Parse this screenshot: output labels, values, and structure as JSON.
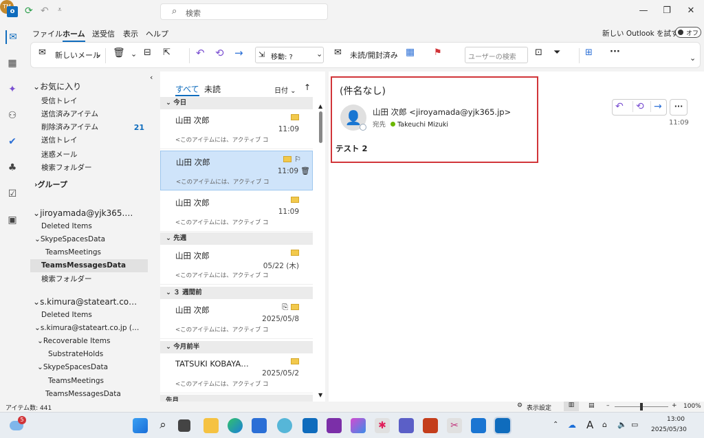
{
  "titlebar": {
    "search_placeholder": "検索",
    "avatar_initials": "TM"
  },
  "menu": {
    "tabs": [
      "ファイル",
      "ホーム",
      "送受信",
      "表示",
      "ヘルプ"
    ],
    "new_outlook_label": "新しい Outlook を試す",
    "toggle_label": "オフ"
  },
  "ribbon": {
    "new_mail": "新しいメール",
    "move_label": "移動: ?",
    "read_unread": "未読/開封済み",
    "user_search_placeholder": "ユーザーの検索",
    "more": "···"
  },
  "folders": {
    "favorites_header": "お気に入り",
    "favorites": [
      "受信トレイ",
      "送信済みアイテム",
      "削除済みアイテム",
      "送信トレイ",
      "迷惑メール",
      "検索フォルダー"
    ],
    "deleted_count": "21",
    "groups_header": "グループ",
    "account1_header": "jiroyamada@yjk365.…",
    "account1_items": [
      "Deleted Items",
      "SkypeSpacesData",
      "TeamsMeetings",
      "TeamsMessagesData",
      "検索フォルダー"
    ],
    "account2_header": "s.kimura@stateart.co…",
    "account2_items": [
      "Deleted Items",
      "s.kimura@stateart.co.jp (…",
      "Recoverable Items",
      "SubstrateHolds",
      "SkypeSpacesData",
      "TeamsMeetings",
      "TeamsMessagesData"
    ]
  },
  "list": {
    "tab_all": "すべて",
    "tab_unread": "未読",
    "sort_label": "日付",
    "groups": [
      "今日",
      "先週",
      "３ 週間前",
      "今月前半"
    ],
    "messages": [
      {
        "sender": "山田 次郎",
        "time": "11:09",
        "preview": "<このアイテムには、アクティブ コ"
      },
      {
        "sender": "山田 次郎",
        "time": "11:09",
        "preview": "<このアイテムには、アクティブ コ"
      },
      {
        "sender": "山田 次郎",
        "time": "11:09",
        "preview": "<このアイテムには、アクティブ コ"
      },
      {
        "sender": "山田 次郎",
        "time": "05/22 (木)",
        "preview": "<このアイテムには、アクティブ コ"
      },
      {
        "sender": "山田 次郎",
        "time": "2025/05/8",
        "preview": "<このアイテムには、アクティブ コ"
      },
      {
        "sender": "TATSUKI KOBAYA…",
        "time": "2025/05/2",
        "preview": "<このアイテムには、アクティブ コ"
      }
    ],
    "bottom_group": "先月"
  },
  "reading": {
    "subject": "(件名なし)",
    "from": "山田 次郎 <jiroyamada@yjk365.jp>",
    "to_label": "宛先",
    "to": "Takeuchi Mizuki",
    "time": "11:09",
    "body": "テスト 2"
  },
  "status": {
    "item_count": "アイテム数: 441",
    "display_settings": "表示設定",
    "zoom": "100%"
  },
  "taskbar": {
    "notification_count": "5",
    "time": "13:00",
    "date": "2025/05/30",
    "ime": "A"
  },
  "colors": {
    "accent": "#0f6cbd",
    "highlight": "#d13438",
    "selected_row": "#cfe4fa"
  }
}
